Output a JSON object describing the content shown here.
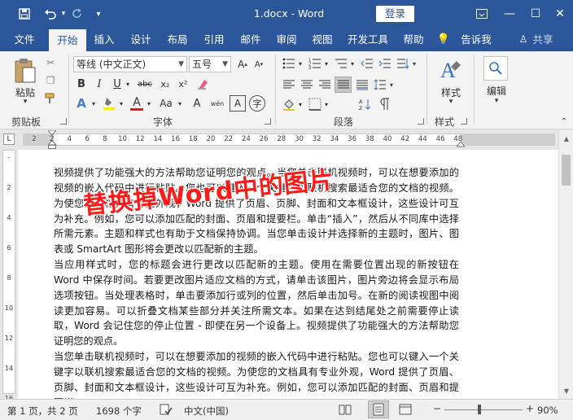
{
  "title_bar": {
    "save_icon": "save-icon",
    "undo_icon": "undo-icon",
    "redo_icon": "redo-icon",
    "customize_icon": "chevron-down-icon",
    "doc_title": "1.docx  -  Word",
    "login_label": "登录",
    "ribbon_display_icon": "ribbon-display-icon",
    "minimize": "—",
    "maximize": "☐",
    "close": "✕"
  },
  "tabs": [
    "文件",
    "开始",
    "插入",
    "设计",
    "布局",
    "引用",
    "邮件",
    "审阅",
    "视图",
    "开发工具",
    "帮助",
    "告诉我",
    "共享"
  ],
  "active_tab": "开始",
  "ribbon": {
    "clipboard": {
      "paste_label": "粘贴",
      "group_label": "剪贴板"
    },
    "font": {
      "font_name": "等线 (中文正文)",
      "font_size": "五号",
      "group_label": "字体",
      "buttons": [
        "B",
        "I",
        "U",
        "abc",
        "x₂",
        "x²",
        "A",
        "Aa",
        "A",
        "A",
        "wén",
        "A",
        "A",
        "字"
      ]
    },
    "paragraph": {
      "group_label": "段落"
    },
    "styles": {
      "styles_label": "样式",
      "group_label": "样式"
    },
    "editing": {
      "editing_label": "编辑"
    }
  },
  "ruler_ticks": [
    "2",
    "2",
    "4",
    "6",
    "8",
    "10",
    "12",
    "14",
    "16",
    "18",
    "20",
    "22",
    "24",
    "26",
    "28",
    "30",
    "32",
    "34",
    "36",
    "38",
    "40",
    "42",
    "44",
    "46",
    "48"
  ],
  "vruler_ticks": [
    "-",
    "2",
    "4",
    "6",
    "8",
    "10",
    "12",
    "14",
    "16"
  ],
  "document": {
    "paragraph_1": "视频提供了功能强大的方法帮助您证明您的观点。当您单击联机视频时，可以在想要添加的视频的嵌入代码中进行粘贴。您也可以键入一个关键字以联机搜索最适合您的文档的视频。为使您的文档具有专业外观，Word 提供了页眉、页脚、封面和文本框设计，这些设计可互为补充。例如，您可以添加匹配的封面、页眉和提要栏。单击“插入”，然后从不同库中选择所需元素。主题和样式也有助于文档保持协调。当您单击设计并选择新的主题时，图片、图表或 SmartArt 图形将会更改以匹配新的主题。",
    "paragraph_2": "当应用样式时，您的标题会进行更改以匹配新的主题。使用在需要位置出现的新按钮在 Word 中保存时间。若要更改图片适应文档的方式，请单击该图片，图片旁边将会显示布局选项按钮。当处理表格时，单击要添加行或列的位置，然后单击加号。在新的阅读视图中阅读更加容易。可以折叠文档某些部分并关注所需文本。如果在达到结尾处之前需要停止读取，Word 会记住您的停止位置 - 即使在另一个设备上。视频提供了功能强大的方法帮助您证明您的观点。",
    "paragraph_3": "当您单击联机视频时，可以在想要添加的视频的嵌入代码中进行粘贴。您也可以键入一个关键字以联机搜索最适合您的文档的视频。为使您的文档具有专业外观，Word 提供了页眉、页脚、封面和文本框设计，这些设计可互为补充。例如，您可以添加匹配的封面、页眉和提要栏。",
    "overlay_text": "替换掉Word中的图片"
  },
  "status_bar": {
    "page": "第 1 页，共 2 页",
    "words": "1698 个字",
    "proofing_icon": "proofing-icon",
    "language": "中文(中国)",
    "zoom": "90%",
    "zoom_level": 0.9
  },
  "colors": {
    "brand": "#2b579a",
    "ribbon_bg": "#f3f3f3",
    "overlay": "#ff1a1a"
  }
}
